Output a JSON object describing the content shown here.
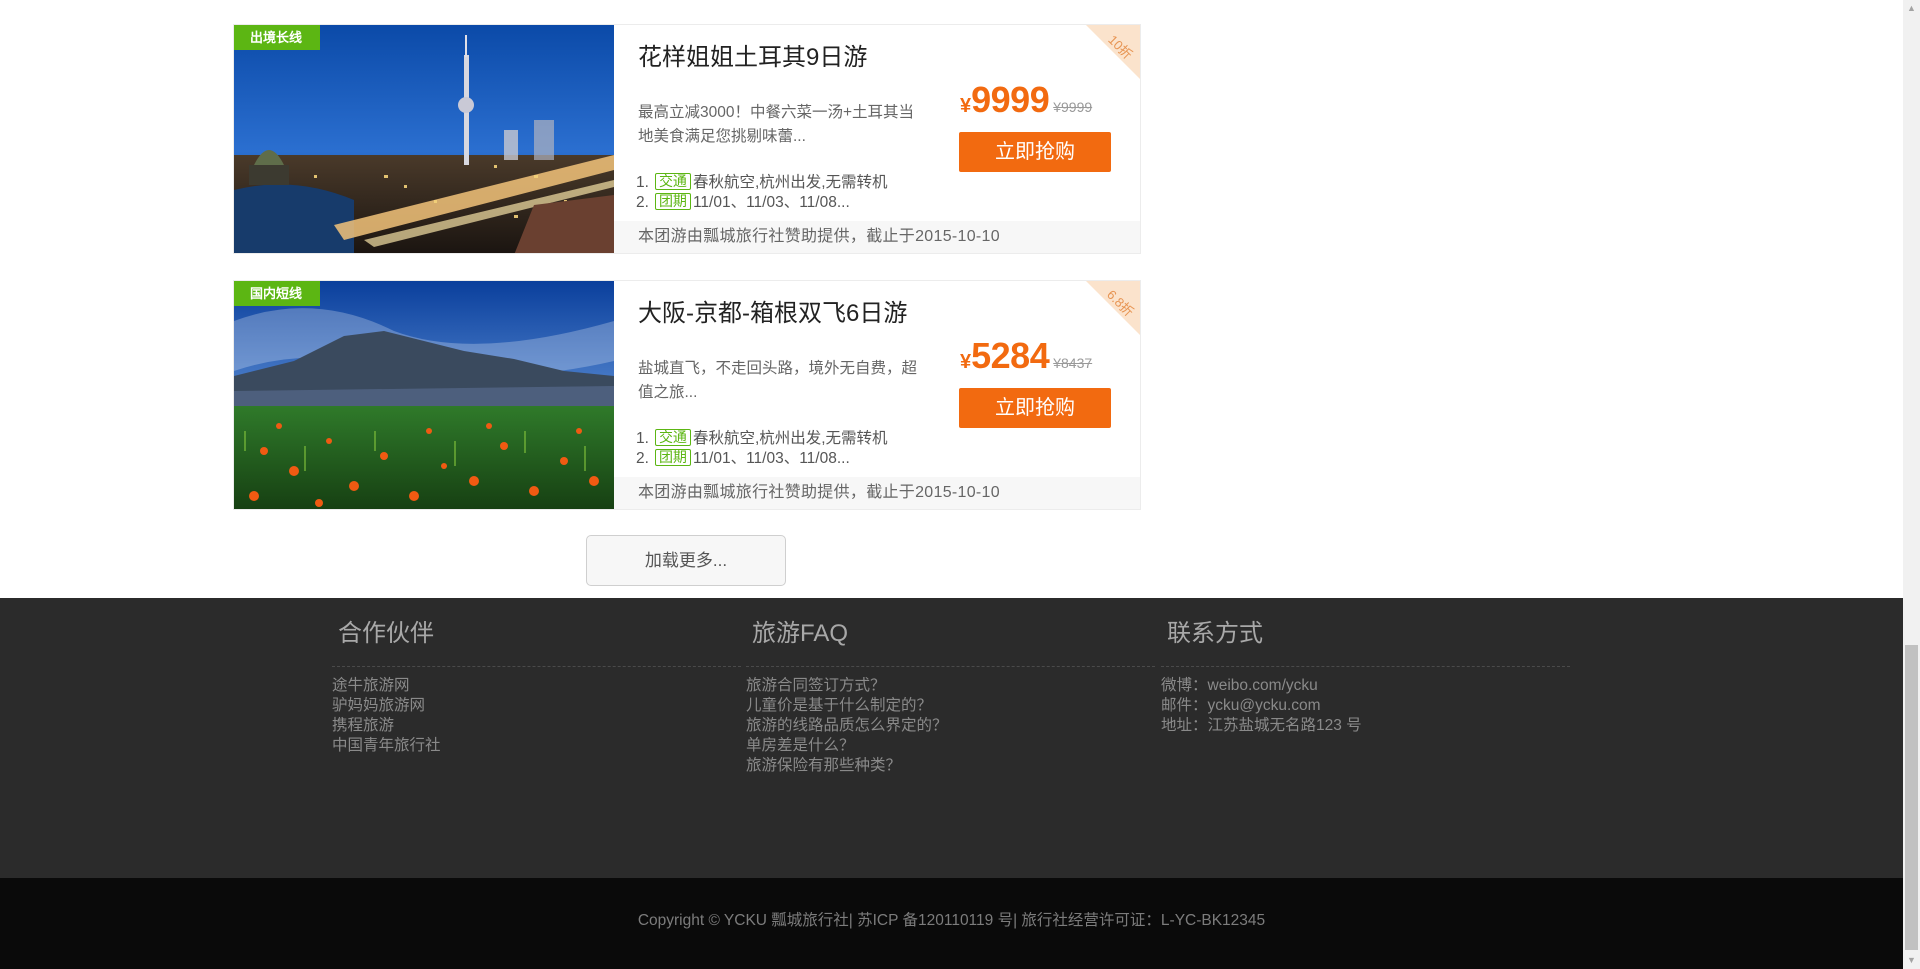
{
  "deals": [
    {
      "tag": "出境长线",
      "title": "花样姐姐土耳其9日游",
      "description": "最高立减3000！中餐六菜一汤+土耳其当地美食满足您挑剔味蕾...",
      "features": [
        {
          "num": "1.",
          "badge": "交通",
          "text": "春秋航空,杭州出发,无需转机"
        },
        {
          "num": "2.",
          "badge": "团期",
          "text": "11/01、11/03、11/08..."
        }
      ],
      "currency": "¥",
      "price": "9999",
      "original_price": "¥9999",
      "buy_label": "立即抢购",
      "discount": "10折",
      "footer": "本团游由瓢城旅行社赞助提供，截止于2015-10-10"
    },
    {
      "tag": "国内短线",
      "title": "大阪-京都-箱根双飞6日游",
      "description": "盐城直飞，不走回头路，境外无自费，超值之旅...",
      "features": [
        {
          "num": "1.",
          "badge": "交通",
          "text": "春秋航空,杭州出发,无需转机"
        },
        {
          "num": "2.",
          "badge": "团期",
          "text": "11/01、11/03、11/08..."
        }
      ],
      "currency": "¥",
      "price": "5284",
      "original_price": "¥8437",
      "buy_label": "立即抢购",
      "discount": "6.8折",
      "footer": "本团游由瓢城旅行社赞助提供，截止于2015-10-10"
    }
  ],
  "load_more": "加载更多...",
  "footer": {
    "partners": {
      "heading": "合作伙伴",
      "links": [
        "途牛旅游网",
        "驴妈妈旅游网",
        "携程旅游",
        "中国青年旅行社"
      ]
    },
    "faq": {
      "heading": "旅游FAQ",
      "links": [
        "旅游合同签订方式？",
        "儿童价是基于什么制定的？",
        "旅游的线路品质怎么界定的？",
        "单房差是什么？",
        "旅游保险有那些种类？"
      ]
    },
    "contact": {
      "heading": "联系方式",
      "links": [
        "微博：weibo.com/ycku",
        "邮件：ycku@ycku.com",
        "地址：江苏盐城无名路123 号"
      ]
    },
    "copyright": "Copyright © YCKU 瓢城旅行社| 苏ICP 备120110119 号| 旅行社经营许可证：L-YC-BK12345"
  },
  "colors": {
    "accent_orange": "#f26a10",
    "tag_green": "#5cb613",
    "footer_bg": "#2b2b2b",
    "copyright_bg": "#0a0a0a"
  }
}
